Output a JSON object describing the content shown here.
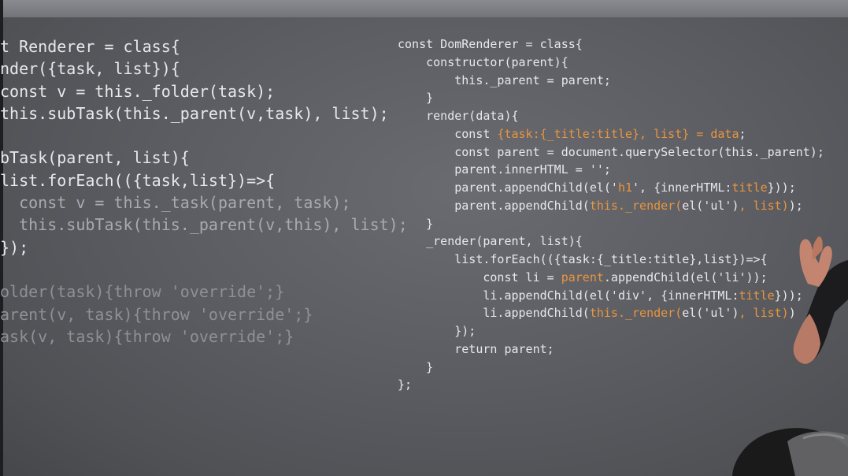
{
  "left_code": [
    {
      "segments": [
        {
          "text": "t Renderer = class{"
        }
      ]
    },
    {
      "segments": [
        {
          "text": "nder({task, list}){"
        }
      ]
    },
    {
      "segments": [
        {
          "text": "const v = this._folder(task);"
        }
      ]
    },
    {
      "segments": [
        {
          "text": "this.subTask(this._parent(v,task), list);"
        }
      ]
    },
    {
      "segments": [
        {
          "text": ""
        }
      ]
    },
    {
      "segments": [
        {
          "text": "bTask(parent, list){"
        }
      ]
    },
    {
      "segments": [
        {
          "text": "list.forEach(({task,list})=>{"
        }
      ]
    },
    {
      "segments": [
        {
          "text": "  const v = this._task(parent, task);",
          "tone": "dim"
        }
      ]
    },
    {
      "segments": [
        {
          "text": "  this.subTask(this._parent(v,this), list);",
          "tone": "dim"
        }
      ]
    },
    {
      "segments": [
        {
          "text": "});"
        }
      ]
    },
    {
      "segments": [
        {
          "text": ""
        }
      ]
    },
    {
      "segments": [
        {
          "text": "older(task){throw 'override';}",
          "tone": "faint"
        }
      ]
    },
    {
      "segments": [
        {
          "text": "arent(v, task){throw 'override';}",
          "tone": "faint"
        }
      ]
    },
    {
      "segments": [
        {
          "text": "ask(v, task){throw 'override';}",
          "tone": "faint"
        }
      ]
    }
  ],
  "right_code": [
    {
      "segments": [
        {
          "text": "const DomRenderer = class{"
        }
      ]
    },
    {
      "segments": [
        {
          "text": "    constructor(parent){"
        }
      ]
    },
    {
      "segments": [
        {
          "text": "        this._parent = parent;"
        }
      ]
    },
    {
      "segments": [
        {
          "text": "    }"
        }
      ]
    },
    {
      "segments": [
        {
          "text": "    render(data){"
        }
      ]
    },
    {
      "segments": [
        {
          "text": "        const "
        },
        {
          "text": "{task:{_title:title}, list} = data",
          "hl": true
        },
        {
          "text": ";"
        }
      ]
    },
    {
      "segments": [
        {
          "text": "        const parent = document.querySelector(this._parent);"
        }
      ]
    },
    {
      "segments": [
        {
          "text": "        parent.innerHTML = '';"
        }
      ]
    },
    {
      "segments": [
        {
          "text": "        parent.appendChild(el('"
        },
        {
          "text": "h1",
          "hl": true
        },
        {
          "text": "', {innerHTML:"
        },
        {
          "text": "title",
          "hl": true
        },
        {
          "text": "}));"
        }
      ]
    },
    {
      "segments": [
        {
          "text": "        parent.appendChild("
        },
        {
          "text": "this._render(",
          "hl": true
        },
        {
          "text": "el('ul')"
        },
        {
          "text": ", list)",
          "hl": true
        },
        {
          "text": ");"
        }
      ]
    },
    {
      "segments": [
        {
          "text": "    }"
        }
      ]
    },
    {
      "segments": [
        {
          "text": "    _render(parent, list){"
        }
      ]
    },
    {
      "segments": [
        {
          "text": "        list.forEach(({task:{_title:title},list})=>{"
        }
      ]
    },
    {
      "segments": [
        {
          "text": "            const li = "
        },
        {
          "text": "parent",
          "hl": true
        },
        {
          "text": ".appendChild(el('li'));"
        }
      ]
    },
    {
      "segments": [
        {
          "text": "            li.appendChild(el('div', {innerHTML:"
        },
        {
          "text": "title",
          "hl": true
        },
        {
          "text": "}));"
        }
      ]
    },
    {
      "segments": [
        {
          "text": "            li.appendChild("
        },
        {
          "text": "this._render(",
          "hl": true
        },
        {
          "text": "el('ul')"
        },
        {
          "text": ", list)",
          "hl": true
        },
        {
          "text": ")"
        }
      ]
    },
    {
      "segments": [
        {
          "text": "        });"
        }
      ]
    },
    {
      "segments": [
        {
          "text": "        return parent;"
        }
      ]
    },
    {
      "segments": [
        {
          "text": "    }"
        }
      ]
    },
    {
      "segments": [
        {
          "text": "};"
        }
      ]
    }
  ],
  "colors": {
    "screen": "#5c5d62",
    "code_text": "#e8e8ec",
    "highlight": "#e8963e",
    "dim_text": "#a9aab0",
    "faint_text": "#8f9096",
    "skin": "#c48570",
    "hair": "#1a1a1a"
  }
}
